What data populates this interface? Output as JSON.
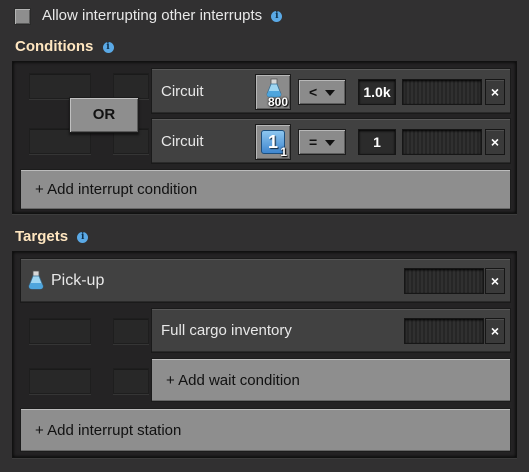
{
  "top": {
    "checkbox_label": "Allow interrupting other interrupts",
    "checked": false
  },
  "conditions": {
    "title": "Conditions",
    "combinator": "OR",
    "rows": [
      {
        "type": "Circuit",
        "signal_icon": "flask-icon",
        "signal_count": "800",
        "operator": "<",
        "value": "1.0k"
      },
      {
        "type": "Circuit",
        "signal_icon": "signal-1-icon",
        "signal_count": "1",
        "signal_glyph": "1",
        "operator": "=",
        "value": "1"
      }
    ],
    "add_label": "+ Add interrupt condition"
  },
  "targets": {
    "title": "Targets",
    "station": {
      "icon": "flask-icon",
      "name": "Pick-up"
    },
    "wait_conditions": [
      {
        "label": "Full cargo inventory"
      }
    ],
    "add_wait_label": "+ Add wait condition",
    "add_station_label": "+ Add interrupt station"
  },
  "close_glyph": "×",
  "info_glyph": "i",
  "colors": {
    "background": "#313031",
    "panel": "#242324",
    "title": "#ffe6c0",
    "button": "#8e8e8e",
    "info": "#5aa9e6",
    "signal_blue": "#4a90d9"
  }
}
